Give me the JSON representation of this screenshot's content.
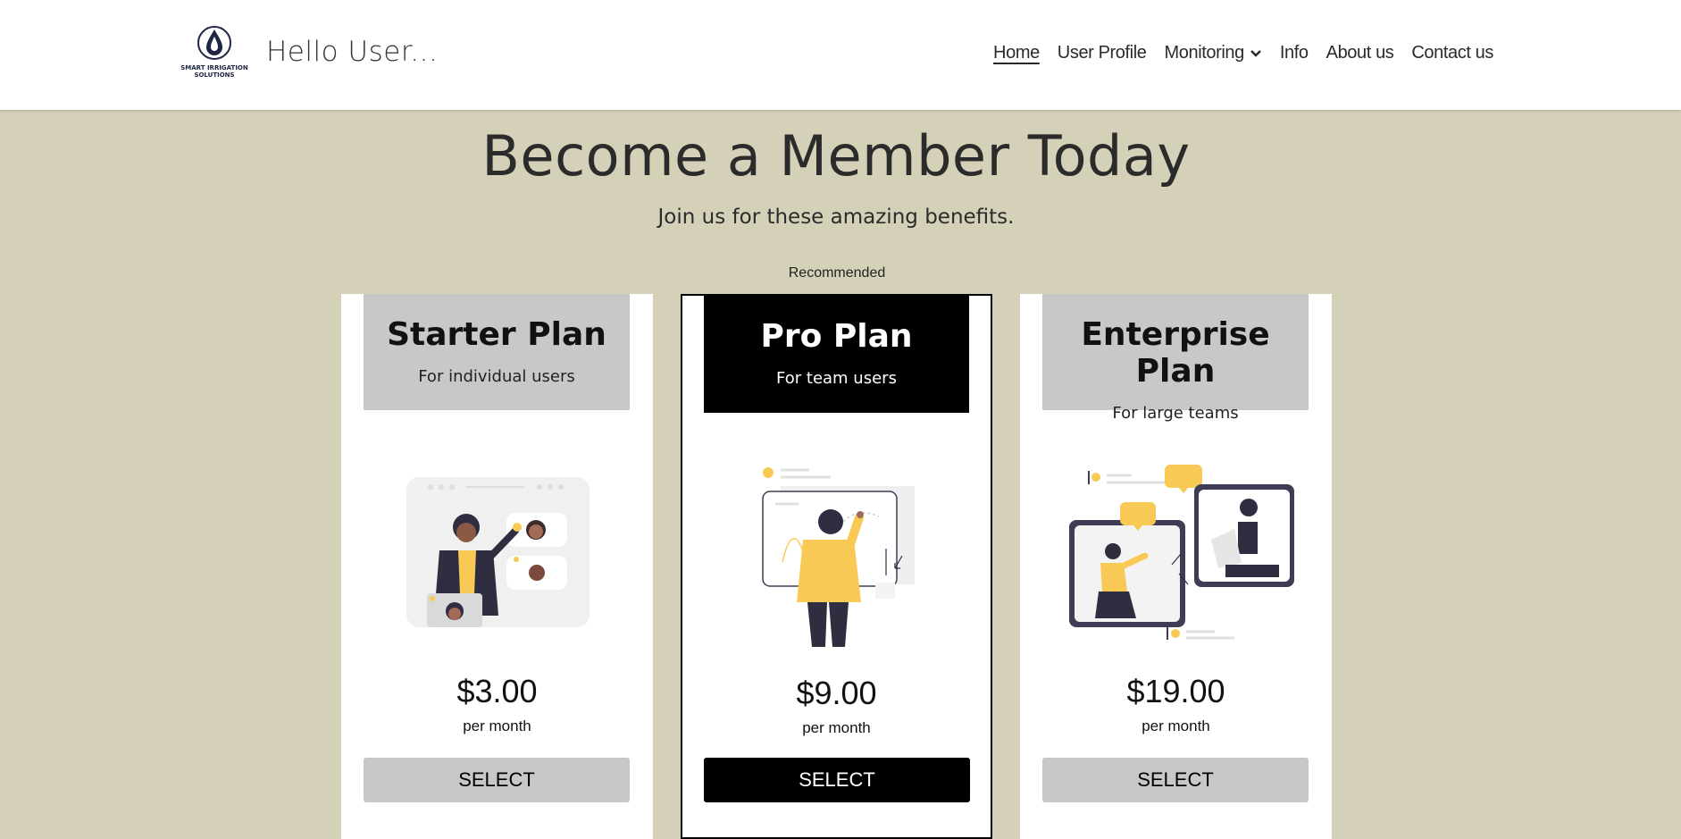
{
  "header": {
    "logo_text": "SMART IRRIGATION SOLUTIONS",
    "greeting": "Hello User...",
    "nav": [
      {
        "label": "Home",
        "active": true
      },
      {
        "label": "User Profile"
      },
      {
        "label": "Monitoring",
        "has_dropdown": true
      },
      {
        "label": "Info"
      },
      {
        "label": "About us"
      },
      {
        "label": "Contact us"
      }
    ]
  },
  "hero": {
    "title": "Become a Member Today",
    "subtitle": "Join us for these amazing benefits."
  },
  "recommended_label": "Recommended",
  "plans": [
    {
      "name": "Starter Plan",
      "description": "For individual users",
      "price": "$3.00",
      "period": "per month",
      "button": "SELECT"
    },
    {
      "name": "Pro Plan",
      "description": "For team users",
      "price": "$9.00",
      "period": "per month",
      "button": "SELECT"
    },
    {
      "name": "Enterprise Plan",
      "description": "For large teams",
      "price": "$19.00",
      "period": "per month",
      "button": "SELECT"
    }
  ],
  "colors": {
    "page_background": "#d5d1b8",
    "card_background": "#ffffff",
    "plan_header_gray": "#c8c8c8",
    "pro_accent": "#000000",
    "illustration_accent": "#f8c954"
  }
}
